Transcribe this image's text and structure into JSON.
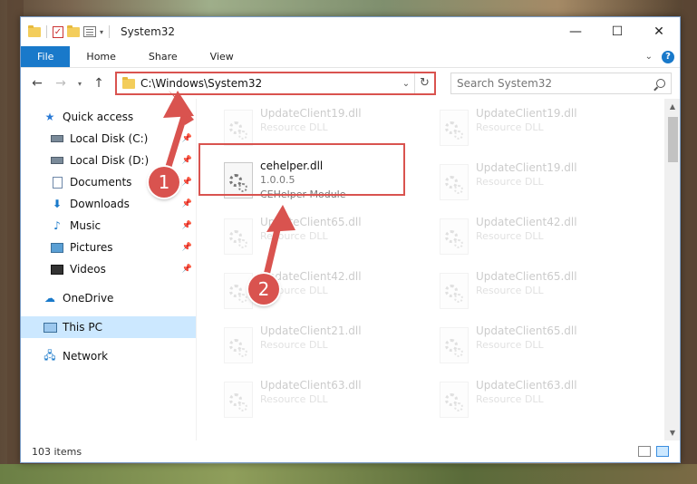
{
  "window": {
    "title": "System32",
    "buttons": {
      "minimize": "—",
      "maximize": "☐",
      "close": "✕"
    }
  },
  "ribbon": {
    "file": "File",
    "home": "Home",
    "share": "Share",
    "view": "View"
  },
  "address": {
    "path": "C:\\Windows\\System32",
    "search_placeholder": "Search System32"
  },
  "sidebar": {
    "items": [
      {
        "label": "Quick access",
        "icon": "star-icon"
      },
      {
        "label": "Local Disk (C:)",
        "icon": "disk-icon",
        "pinned": true
      },
      {
        "label": "Local Disk (D:)",
        "icon": "disk-icon",
        "pinned": true
      },
      {
        "label": "Documents",
        "icon": "documents-icon",
        "pinned": true
      },
      {
        "label": "Downloads",
        "icon": "downloads-icon",
        "pinned": true
      },
      {
        "label": "Music",
        "icon": "music-icon",
        "pinned": true
      },
      {
        "label": "Pictures",
        "icon": "pictures-icon",
        "pinned": true
      },
      {
        "label": "Videos",
        "icon": "videos-icon",
        "pinned": true
      },
      {
        "label": "OneDrive",
        "icon": "onedrive-icon"
      },
      {
        "label": "This PC",
        "icon": "pc-icon",
        "selected": true
      },
      {
        "label": "Network",
        "icon": "network-icon"
      }
    ]
  },
  "files": {
    "highlighted": {
      "name": "cehelper.dll",
      "version": "1.0.0.5",
      "description": "CEHelper Module"
    },
    "left_column": [
      {
        "name": "UpdateClient19.dll",
        "type": "Resource DLL"
      },
      {
        "name": "UpdateClient65.dll",
        "type": "Resource DLL"
      },
      {
        "name": "UpdateClient42.dll",
        "type": "Resource DLL"
      },
      {
        "name": "UpdateClient21.dll",
        "type": "Resource DLL"
      },
      {
        "name": "UpdateClient63.dll",
        "type": "Resource DLL"
      }
    ],
    "right_column": [
      {
        "name": "UpdateClient19.dll",
        "type": "Resource DLL"
      },
      {
        "name": "UpdateClient19.dll",
        "type": "Resource DLL"
      },
      {
        "name": "UpdateClient42.dll",
        "type": "Resource DLL"
      },
      {
        "name": "UpdateClient65.dll",
        "type": "Resource DLL"
      },
      {
        "name": "UpdateClient65.dll",
        "type": "Resource DLL"
      },
      {
        "name": "UpdateClient63.dll",
        "type": "Resource DLL"
      }
    ]
  },
  "status": {
    "count": "103 items"
  },
  "callouts": {
    "one": "1",
    "two": "2"
  },
  "colors": {
    "accent": "#1979ca",
    "highlight": "#d9534f",
    "selected": "#cce8ff"
  }
}
